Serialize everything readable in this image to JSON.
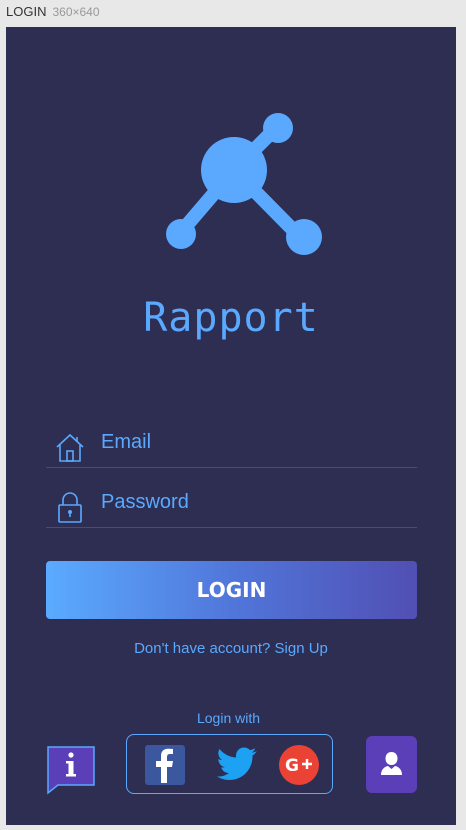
{
  "frame": {
    "title": "LOGIN",
    "dimensions": "360×640"
  },
  "app": {
    "name": "Rapport",
    "logo_icon": "molecule-network-icon"
  },
  "form": {
    "email_placeholder": "Email",
    "password_placeholder": "Password",
    "email_icon": "home-icon",
    "password_icon": "lock-icon"
  },
  "login_button": {
    "label": "LOGIN"
  },
  "signup_link": {
    "label": "Don't have account? Sign Up"
  },
  "social": {
    "label": "Login with",
    "providers": [
      "facebook",
      "twitter",
      "google-plus"
    ]
  },
  "colors": {
    "background": "#2d2e52",
    "accent": "#5aa9ff",
    "underline": "#4b3cc8",
    "button_gradient_start": "#5aabff",
    "button_gradient_end": "#514fb3",
    "facebook": "#3b579d",
    "twitter": "#1da1f2",
    "google": "#ea4335",
    "profile": "#5a3fb8"
  }
}
